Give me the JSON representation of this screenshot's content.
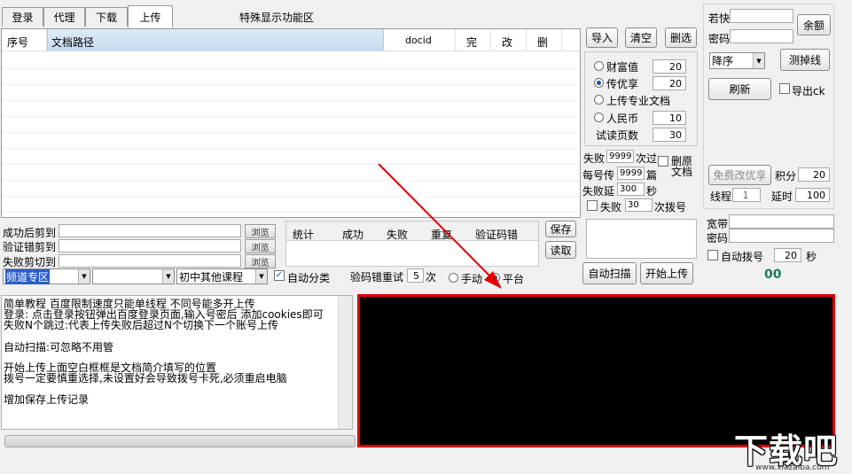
{
  "tabs": [
    "登录",
    "代理",
    "下载",
    "上传"
  ],
  "header_title": "特殊显示功能区",
  "grid": {
    "columns": [
      "序号",
      "文档路径",
      "docid",
      "完",
      "改",
      "删"
    ]
  },
  "top_buttons": {
    "import": "导入",
    "clear": "清空",
    "delete_selected": "删选"
  },
  "upload_options": [
    {
      "label": "财富值",
      "value": "20",
      "selected": false
    },
    {
      "label": "传优享",
      "value": "20",
      "selected": true
    },
    {
      "label": "上传专业文档",
      "value": "",
      "selected": false
    },
    {
      "label": "人民币",
      "value": "10",
      "selected": false
    }
  ],
  "trial_pages": {
    "label": "试读页数",
    "value": "30"
  },
  "fail_settings": {
    "fail_label": "失败",
    "fail_value": "9999",
    "skip_label": "次过",
    "delete_original_label": "删原",
    "document_label": "文档",
    "per_account_label": "每号传",
    "per_account_value": "9999",
    "per_account_unit": "篇",
    "delay_label": "失败延",
    "delay_value": "300",
    "delay_unit": "秒",
    "fail2_label": "失败",
    "fail2_value": "30",
    "redial_label": "次拨号"
  },
  "paths": [
    {
      "label": "成功后剪到",
      "value": "",
      "browse": "浏览"
    },
    {
      "label": "验证错剪到",
      "value": "",
      "browse": "浏览"
    },
    {
      "label": "失败剪切到",
      "value": "",
      "browse": "浏览"
    }
  ],
  "stats": {
    "headers": [
      "统计",
      "成功",
      "失败",
      "重复",
      "验证码错"
    ]
  },
  "save_button": "保存",
  "read_button": "读取",
  "combos": {
    "category1": "频道专区",
    "category2": "",
    "category3": "初中其他课程"
  },
  "auto_classify": {
    "label": "自动分类",
    "checked": true
  },
  "captcha_retry": {
    "label": "验码错重试",
    "value": "5",
    "unit": "次"
  },
  "mode_radio": {
    "manual": "手动",
    "platform": "平台",
    "platform_selected": true
  },
  "auto_scan_button": "自动扫描",
  "start_upload_button": "开始上传",
  "right_panel": {
    "ruokuai_label": "若快",
    "password_label": "密码",
    "balance_button": "余额",
    "sort_value": "降序",
    "test_line_button": "测掉线",
    "refresh_button": "刷新",
    "export_ck_label": "导出ck",
    "free_change_button": "免费改优享",
    "points_label": "积分",
    "points_value": "20",
    "threads_label": "线程",
    "threads_value": "1",
    "delay_label": "延时",
    "delay_value": "100"
  },
  "broadband": {
    "account_label": "宽带",
    "password_label": "密码",
    "auto_dial_label": "自动拨号",
    "auto_dial_value": "20",
    "auto_dial_unit": "秒",
    "counter": "00"
  },
  "log_lines": [
    "简单教程 百度限制速度只能单线程 不同号能多开上传",
    "登录: 点击登录按钮弹出百度登录页面,输入号密后 添加cookies即可",
    "失败N个跳过:代表上传失败后超过N个切换下一个账号上传",
    "",
    "自动扫描:可忽略不用管",
    "",
    "开始上传上面空白框框是文档简介填写的位置",
    "拨号一定要慎重选择,未设置好会导致拨号卡死,必须重启电脑",
    "",
    "增加保存上传记录"
  ],
  "watermark": {
    "text": "下载吧",
    "url": "www.xiazaiba.com"
  },
  "colors": {
    "highlight_box_border": "#e00000",
    "annotation_arrow": "#e00000",
    "counter_text": "#1a7a5a"
  }
}
